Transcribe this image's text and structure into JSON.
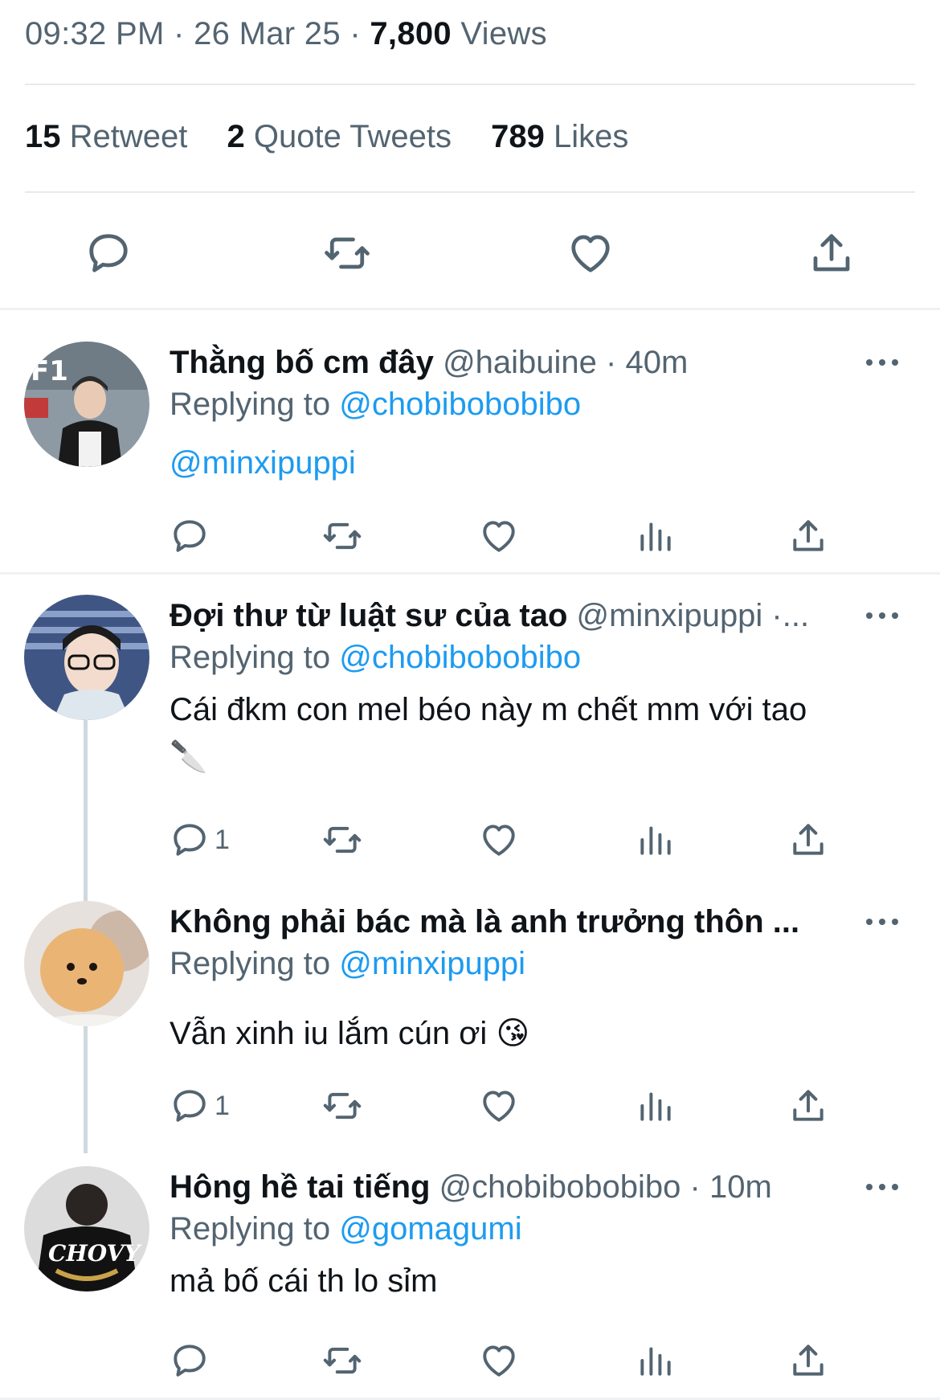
{
  "tweet": {
    "time": "09:32 PM",
    "date": "26 Mar 25",
    "views_count": "7,800",
    "views_label": "Views",
    "stats": {
      "retweets_count": "15",
      "retweets_label": "Retweet",
      "quotes_count": "2",
      "quotes_label": "Quote Tweets",
      "likes_count": "789",
      "likes_label": "Likes"
    },
    "actions": [
      "reply-icon",
      "retweet-icon",
      "like-icon",
      "share-icon"
    ]
  },
  "replies": [
    {
      "name": "Thằng bố cm đây",
      "handle": "@haibuine",
      "time": "· 40m",
      "replying_label": "Replying to",
      "replying_to": "@chobibobobibo",
      "text": "@minxipuppi",
      "text_is_link": true,
      "reply_count": "",
      "avatar_colors": [
        "#7b8a94",
        "#c23b3b",
        "#1a1a1a"
      ]
    },
    {
      "name": "Đợi thư từ luật sư của tao",
      "handle": "@minxipuppi ·...",
      "time": "",
      "replying_label": "Replying to",
      "replying_to": "@chobibobobibo",
      "text": "Cái đkm con mel béo này m chết mm với tao",
      "emoji": "🔪",
      "reply_count": "1",
      "avatar_colors": [
        "#5a6f9a",
        "#f1d8c8",
        "#222222"
      ]
    },
    {
      "name": "Không phải bác mà là anh trưởng thôn ...",
      "handle": "",
      "time": "",
      "replying_label": "Replying to",
      "replying_to": "@minxipuppi",
      "text": "Vẫn xinh iu lắm cún ơi",
      "emoji": "😘",
      "reply_count": "1",
      "avatar_colors": [
        "#e8e4df",
        "#e7b06a",
        "#3a2a20"
      ]
    },
    {
      "name": "Hông hề tai tiếng",
      "handle": "@chobibobobibo",
      "time": "· 10m",
      "replying_label": "Replying to",
      "replying_to": "@gomagumi",
      "text": "mả bố cái th lo sỉm",
      "reply_count": "",
      "avatar_colors": [
        "#d9d9d9",
        "#111111",
        "#ffffff"
      ]
    }
  ],
  "colors": {
    "accent": "#1d9bf0",
    "secondary_text": "#536471",
    "primary_text": "#0f1419",
    "thread_line": "#cfd9de"
  }
}
